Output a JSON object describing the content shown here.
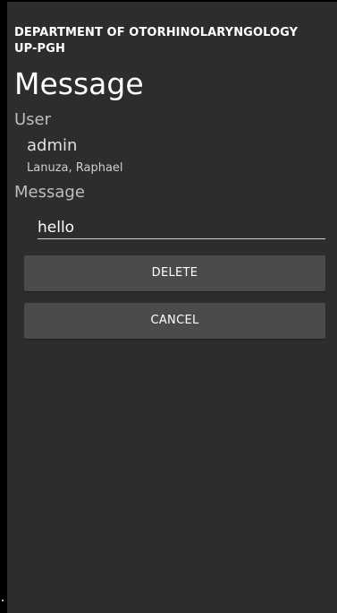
{
  "header": {
    "department": "DEPARTMENT OF OTORHINOLARYNGOLOGY UP-PGH"
  },
  "screen": {
    "title": "Message"
  },
  "user_section": {
    "label": "User",
    "username": "admin",
    "full_name": "Lanuza, Raphael"
  },
  "message_section": {
    "label": "Message",
    "value": "hello"
  },
  "actions": {
    "delete_label": "DELETE",
    "cancel_label": "CANCEL"
  },
  "colors": {
    "background": "#000000",
    "panel": "#2d2d2d",
    "button": "#4b4b4b",
    "text": "#ffffff",
    "muted_text": "#bdbdbd"
  }
}
